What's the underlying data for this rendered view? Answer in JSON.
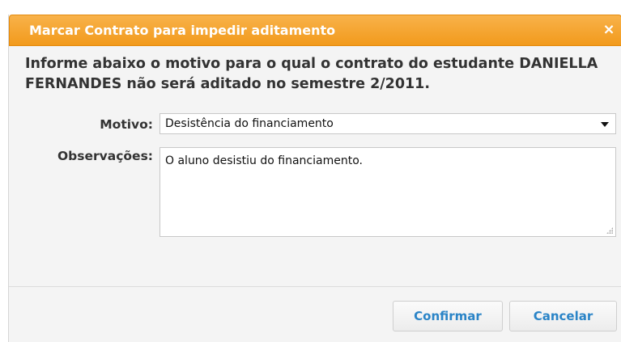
{
  "dialog": {
    "title": "Marcar Contrato para impedir aditamento",
    "close_label": "×",
    "intro_text": "Informe abaixo o motivo para o qual o contrato do estudante DANIELLA FERNANDES não será aditado no semestre 2/2011.",
    "form": {
      "motivo_label": "Motivo:",
      "motivo_value": "Desistência do financiamento",
      "observacoes_label": "Observações:",
      "observacoes_value": "O aluno desistiu do financiamento."
    },
    "buttons": {
      "confirm_label": "Confirmar",
      "cancel_label": "Cancelar"
    }
  },
  "colors": {
    "titlebar": "#f29a1c",
    "button_text": "#2a84c7",
    "panel_bg": "#f4f4f4"
  }
}
